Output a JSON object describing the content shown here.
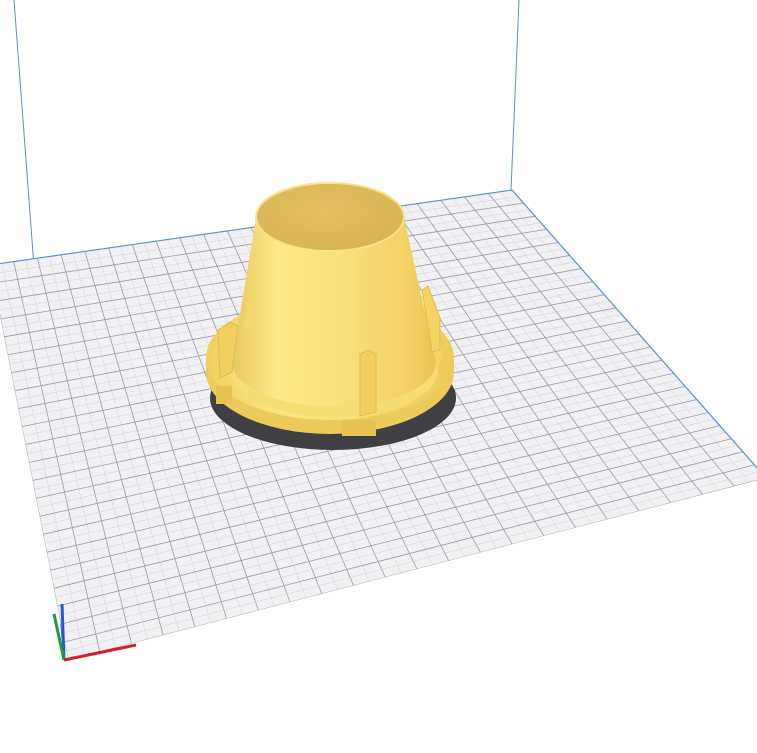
{
  "viewport": {
    "background_color": "#ffffff",
    "build_plate": {
      "fill_color": "#f1f1f3",
      "minor_grid_color": "#d0d0d6",
      "major_grid_color": "#9a9aa4",
      "edge_color": "#5b8fd9"
    },
    "build_volume_edge_color": "#5b8fd9",
    "model": {
      "shape": "truncated-cone-cap-with-ribs",
      "color": "#f5d86a",
      "shadow_color": "#3f3f44"
    },
    "axis_gizmo": {
      "x_color": "#d0212a",
      "y_color": "#1f9b3a",
      "z_color": "#2855d8"
    }
  }
}
